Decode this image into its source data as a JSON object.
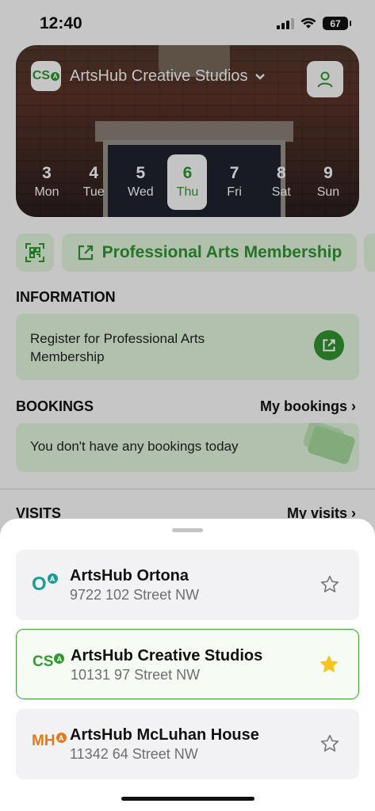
{
  "status_bar": {
    "time": "12:40",
    "battery": "67"
  },
  "header": {
    "studio_logo": "CS",
    "studio_name": "ArtsHub Creative Studios"
  },
  "days": [
    {
      "num": "3",
      "name": "Mon",
      "active": false
    },
    {
      "num": "4",
      "name": "Tue",
      "active": false
    },
    {
      "num": "5",
      "name": "Wed",
      "active": false
    },
    {
      "num": "6",
      "name": "Thu",
      "active": true
    },
    {
      "num": "7",
      "name": "Fri",
      "active": false
    },
    {
      "num": "8",
      "name": "Sat",
      "active": false
    },
    {
      "num": "9",
      "name": "Sun",
      "active": false
    }
  ],
  "actions": {
    "membership_label": "Professional Arts Membership"
  },
  "information": {
    "heading": "INFORMATION",
    "card_text": "Register for Professional Arts Membership"
  },
  "bookings": {
    "heading": "BOOKINGS",
    "link": "My bookings ›",
    "empty_text": "You don't have any bookings today"
  },
  "visits": {
    "heading": "VISITS",
    "link": "My visits ›"
  },
  "locations": [
    {
      "logo": "O",
      "logo_color": "#1a9e93",
      "name": "ArtsHub Ortona",
      "address": "9722 102 Street NW",
      "favorite": false,
      "selected": false
    },
    {
      "logo": "CS",
      "logo_color": "#2f9a2f",
      "name": "ArtsHub Creative Studios",
      "address": "10131 97 Street NW",
      "favorite": true,
      "selected": true
    },
    {
      "logo": "MH",
      "logo_color": "#e07a1e",
      "name": "ArtsHub McLuhan House",
      "address": "11342 64 Street NW",
      "favorite": false,
      "selected": false
    }
  ],
  "colors": {
    "accent": "#2f8f2f",
    "selected_border": "#3aa03a",
    "star_filled": "#f5c518"
  }
}
